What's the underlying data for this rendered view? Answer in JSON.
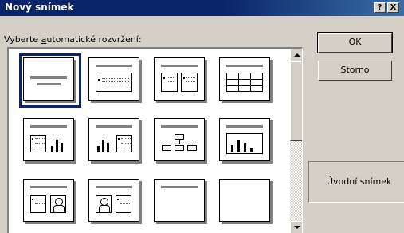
{
  "window": {
    "title": "Nový snímek",
    "help_label": "?",
    "close_label": "X"
  },
  "prompt": {
    "prefix": "Vyberte ",
    "underlined": "a",
    "suffix": "utomatické rozvržení:"
  },
  "buttons": {
    "ok": "OK",
    "cancel": "Storno"
  },
  "preview": {
    "name": "Úvodní snímek"
  },
  "layouts": [
    {
      "icon": "title-slide-icon",
      "selected": true
    },
    {
      "icon": "bulleted-list-icon",
      "selected": false
    },
    {
      "icon": "two-column-text-icon",
      "selected": false
    },
    {
      "icon": "table-icon",
      "selected": false
    },
    {
      "icon": "text-and-chart-icon",
      "selected": false
    },
    {
      "icon": "chart-and-text-icon",
      "selected": false
    },
    {
      "icon": "organization-chart-icon",
      "selected": false
    },
    {
      "icon": "chart-icon",
      "selected": false
    },
    {
      "icon": "text-and-clip-art-icon",
      "selected": false
    },
    {
      "icon": "clip-art-and-text-icon",
      "selected": false
    },
    {
      "icon": "title-only-icon",
      "selected": false
    },
    {
      "icon": "blank-icon",
      "selected": false
    }
  ]
}
